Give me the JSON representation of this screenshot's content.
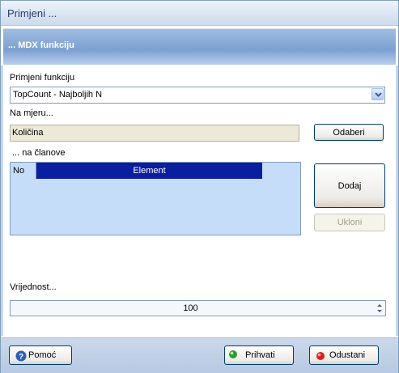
{
  "window": {
    "title": "Primjeni ..."
  },
  "banner": {
    "title": "... MDX funkciju"
  },
  "function": {
    "label": "Primjeni funkciju",
    "selected": "TopCount - Najboljih N"
  },
  "measure": {
    "label": "Na mjeru...",
    "value": "Količina",
    "select_button": "Odaberi"
  },
  "members": {
    "label": "... na članove",
    "columns": [
      "No",
      "Element"
    ],
    "add_button": "Dodaj",
    "remove_button": "Ukloni"
  },
  "value": {
    "label": "Vrijednost...",
    "number": "100"
  },
  "footer": {
    "help_button": "Pomoć",
    "accept_button": "Prihvati",
    "cancel_button": "Odustani"
  },
  "colors": {
    "header_selected": "#0a1ea0",
    "accept_icon": "#2e9b2e",
    "cancel_icon": "#d92020",
    "help_icon": "#2b5fb8"
  }
}
